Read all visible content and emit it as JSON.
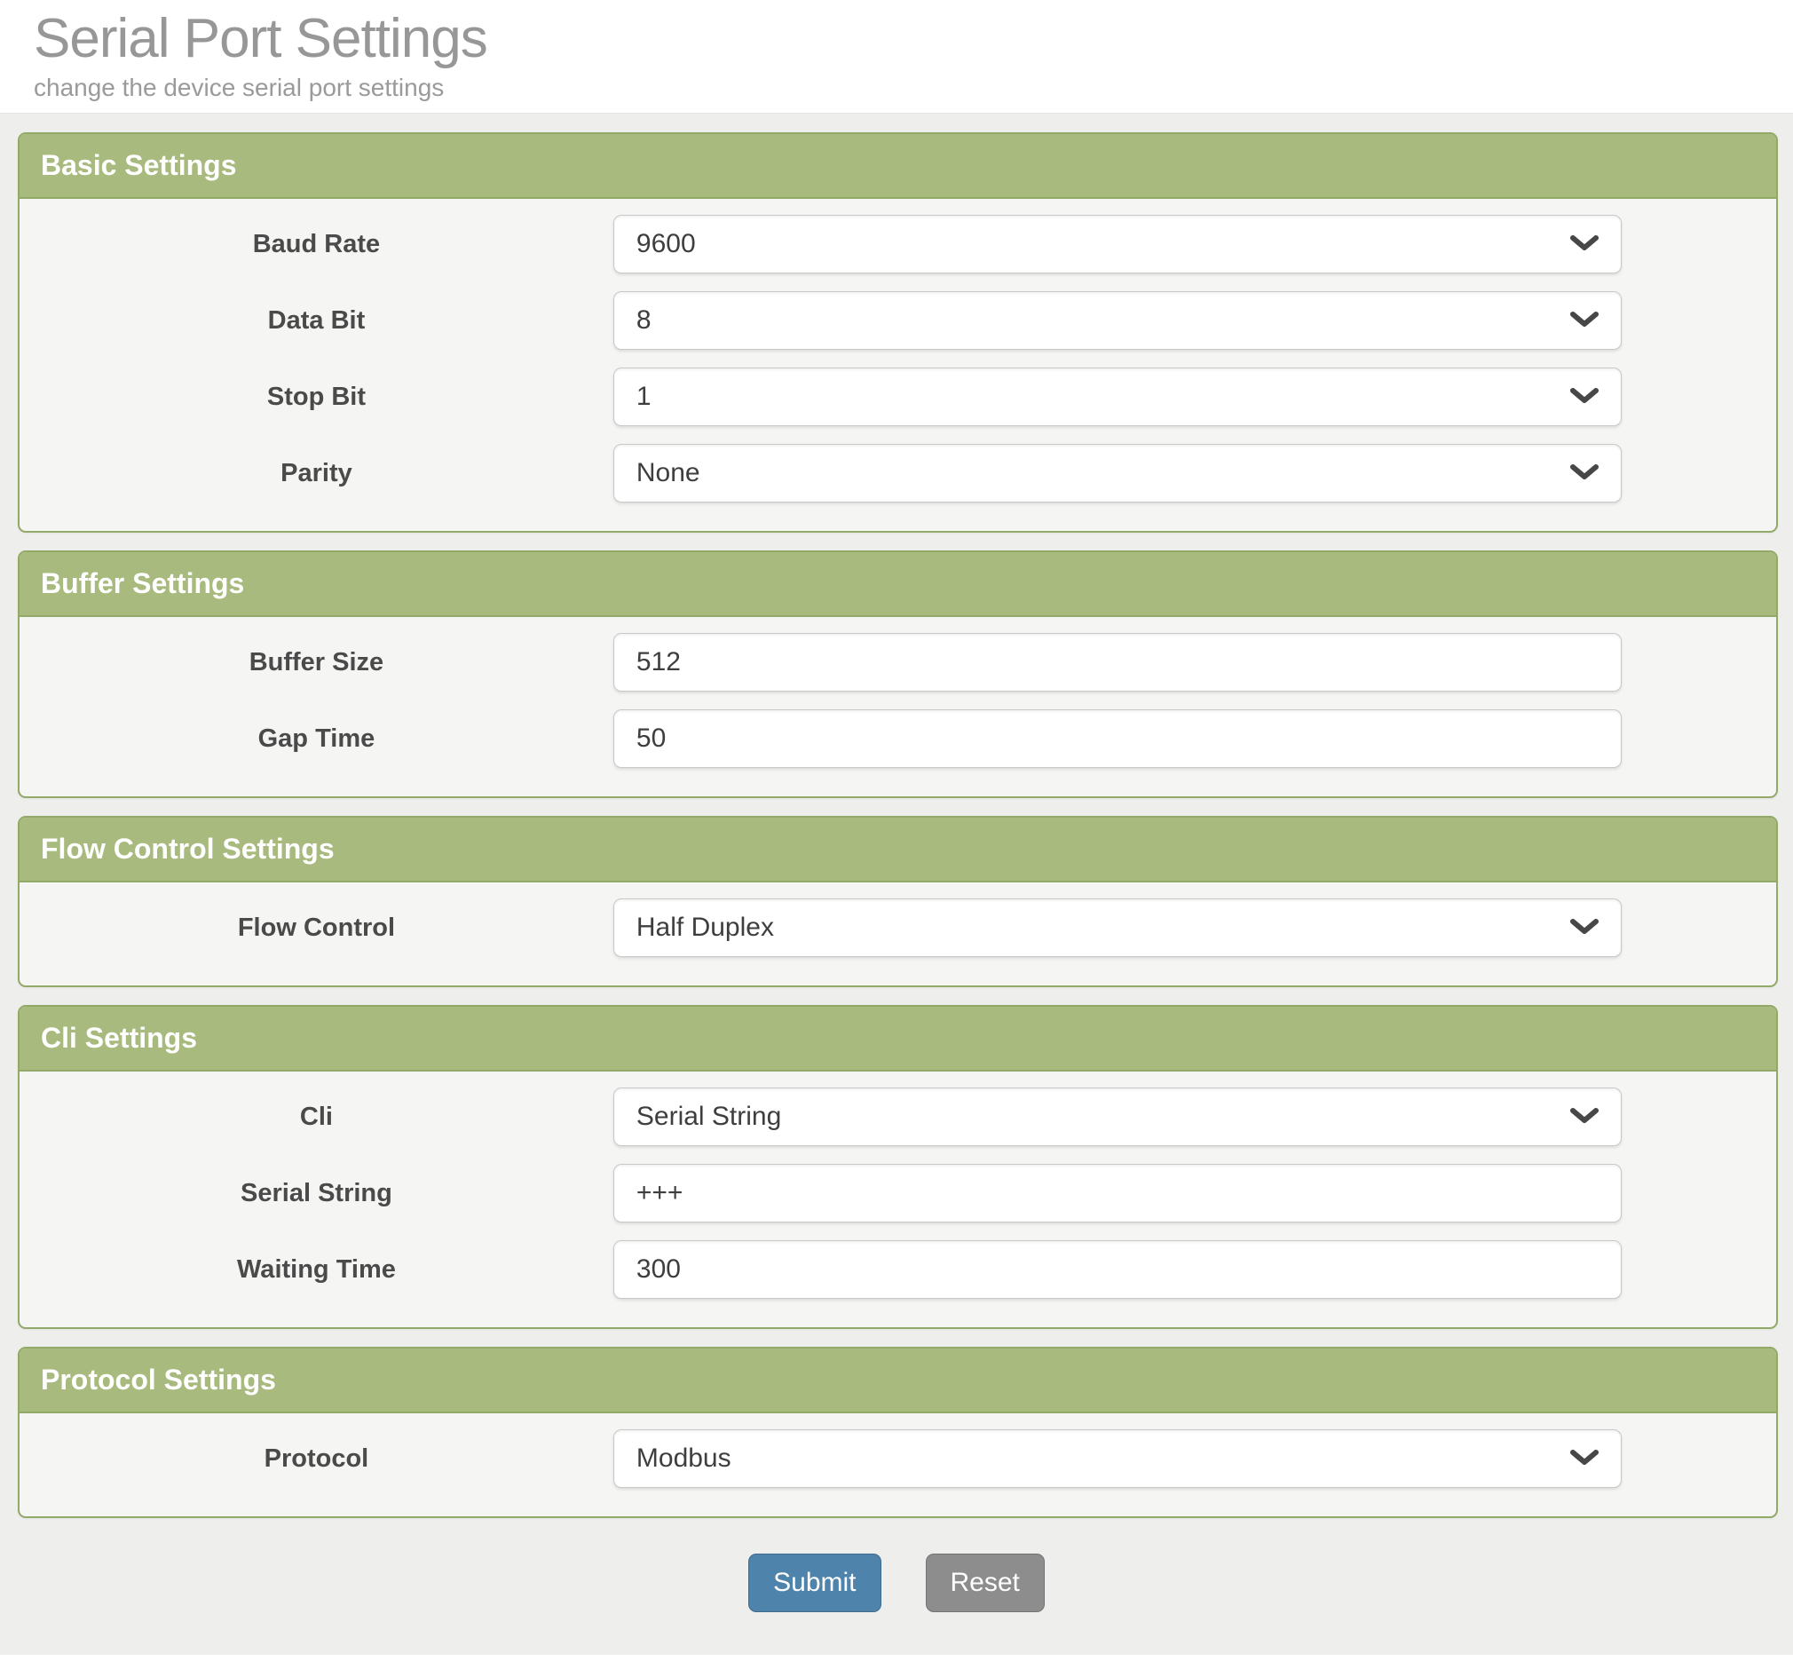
{
  "header": {
    "title": "Serial Port Settings",
    "subtitle": "change the device serial port settings"
  },
  "sections": [
    {
      "title": "Basic Settings",
      "rows": [
        {
          "label": "Baud Rate",
          "control": "select",
          "value": "9600"
        },
        {
          "label": "Data Bit",
          "control": "select",
          "value": "8"
        },
        {
          "label": "Stop Bit",
          "control": "select",
          "value": "1"
        },
        {
          "label": "Parity",
          "control": "select",
          "value": "None"
        }
      ]
    },
    {
      "title": "Buffer Settings",
      "rows": [
        {
          "label": "Buffer Size",
          "control": "text",
          "value": "512"
        },
        {
          "label": "Gap Time",
          "control": "text",
          "value": "50"
        }
      ]
    },
    {
      "title": "Flow Control Settings",
      "rows": [
        {
          "label": "Flow Control",
          "control": "select",
          "value": "Half Duplex"
        }
      ]
    },
    {
      "title": "Cli Settings",
      "rows": [
        {
          "label": "Cli",
          "control": "select",
          "value": "Serial String"
        },
        {
          "label": "Serial String",
          "control": "text",
          "value": "+++"
        },
        {
          "label": "Waiting Time",
          "control": "text",
          "value": "300"
        }
      ]
    },
    {
      "title": "Protocol Settings",
      "rows": [
        {
          "label": "Protocol",
          "control": "select",
          "value": "Modbus"
        }
      ]
    }
  ],
  "actions": {
    "submit_label": "Submit",
    "reset_label": "Reset"
  },
  "icons": {
    "select_indicator": "chevron-down-icon"
  },
  "colors": {
    "section_header_green": "#a8ba7e",
    "section_border_green": "#93a967",
    "submit_button_blue": "#4e83ac",
    "reset_button_gray": "#8d8d8d",
    "page_background": "#eeeeec",
    "panel_background": "#f5f5f3"
  }
}
